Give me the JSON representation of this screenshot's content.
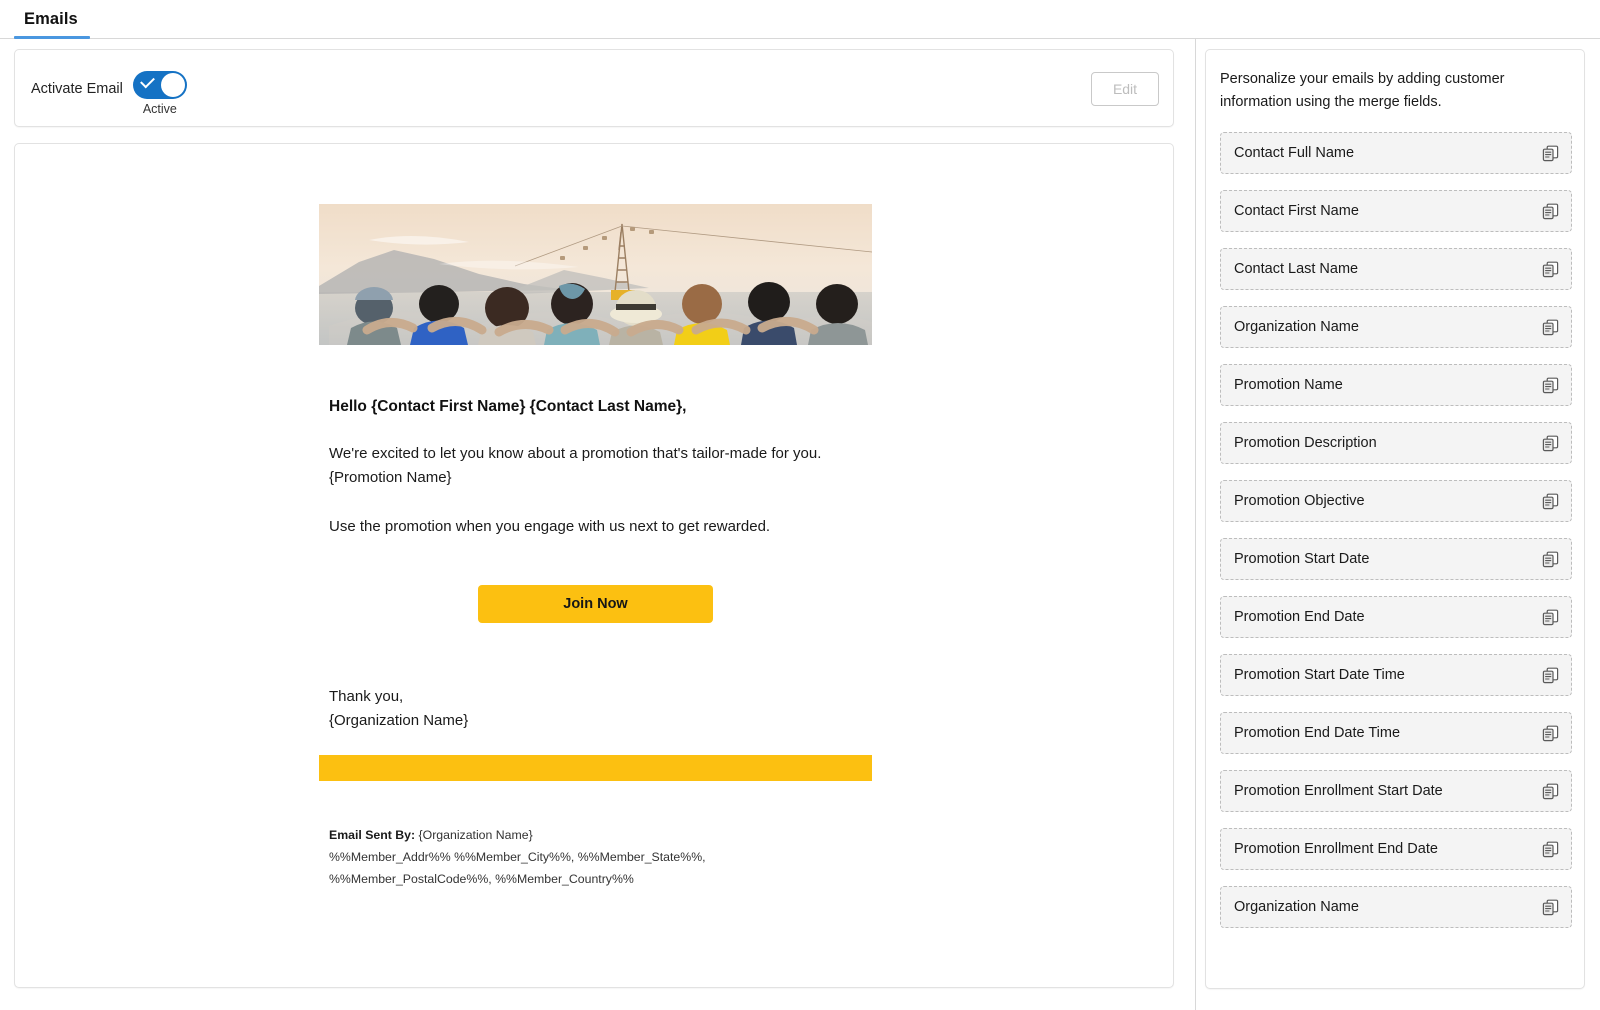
{
  "tabs": [
    {
      "label": "Emails",
      "active": true
    }
  ],
  "activate": {
    "label": "Activate Email",
    "toggle_state": "Active",
    "toggle_on": true,
    "edit_label": "Edit",
    "edit_disabled": true
  },
  "email": {
    "hero_alt": "group-of-friends-sunset-photo",
    "greeting": "Hello {Contact First Name} {Contact Last Name},",
    "paragraph_1": "We're excited to let you know about a promotion that's tailor-made for you. {Promotion Name}",
    "paragraph_2": "Use the promotion when you engage with us next to get rewarded.",
    "cta_label": "Join Now",
    "closing_line_1": "Thank you,",
    "closing_line_2": "{Organization Name}",
    "footer_sent_by_label": "Email Sent By:",
    "footer_sent_by_value": "{Organization Name}",
    "footer_address_line_1": "%%Member_Addr%% %%Member_City%%, %%Member_State%%,",
    "footer_address_line_2": "%%Member_PostalCode%%, %%Member_Country%%"
  },
  "merge_panel": {
    "description": "Personalize your emails by adding customer information using the merge fields.",
    "copy_icon_name": "copy-icon",
    "fields": [
      {
        "label": "Contact Full Name"
      },
      {
        "label": "Contact First Name"
      },
      {
        "label": "Contact Last Name"
      },
      {
        "label": "Organization Name"
      },
      {
        "label": "Promotion Name"
      },
      {
        "label": "Promotion Description"
      },
      {
        "label": "Promotion Objective"
      },
      {
        "label": "Promotion Start Date"
      },
      {
        "label": "Promotion End Date"
      },
      {
        "label": "Promotion Start Date Time"
      },
      {
        "label": "Promotion End Date Time"
      },
      {
        "label": "Promotion Enrollment Start Date"
      },
      {
        "label": "Promotion Enrollment End Date"
      },
      {
        "label": "Organization Name"
      }
    ]
  },
  "colors": {
    "tab_accent": "#4a97e0",
    "toggle_on": "#1572c4",
    "cta_yellow": "#fcc011",
    "card_border": "#e2e2e2",
    "merge_item_bg": "#f4f4f4"
  }
}
